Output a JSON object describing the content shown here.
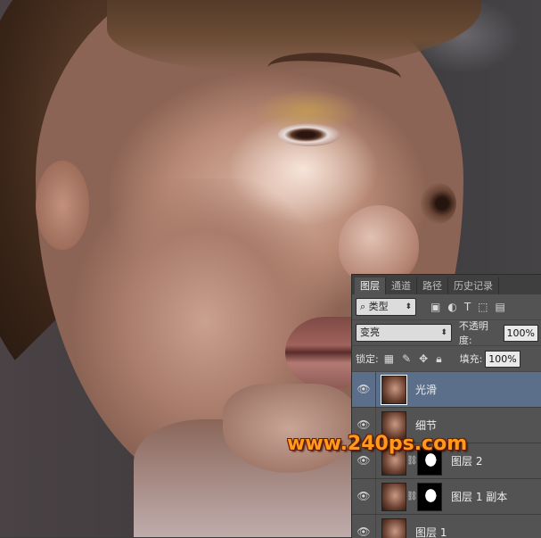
{
  "panel": {
    "tabs": [
      {
        "label": "图层",
        "active": true
      },
      {
        "label": "通道",
        "active": false
      },
      {
        "label": "路径",
        "active": false
      },
      {
        "label": "历史记录",
        "active": false
      }
    ],
    "filter": {
      "label": "类型",
      "icon": "search-icon"
    },
    "filter_icons": [
      "image-icon",
      "adjustment-circle-icon",
      "type-t-icon",
      "shape-icon",
      "smart-object-icon"
    ],
    "blend_mode": "变亮",
    "opacity_label": "不透明度:",
    "opacity_value": "100%",
    "lock_label": "锁定:",
    "lock_icons": [
      "lock-transparent-icon",
      "lock-brush-icon",
      "lock-move-icon",
      "lock-all-icon"
    ],
    "fill_label": "填充:",
    "fill_value": "100%",
    "layers": [
      {
        "name": "光滑",
        "selected": true,
        "has_mask": false
      },
      {
        "name": "细节",
        "selected": false,
        "has_mask": false
      },
      {
        "name": "图层 2",
        "selected": false,
        "has_mask": true
      },
      {
        "name": "图层 1 副本",
        "selected": false,
        "has_mask": true
      },
      {
        "name": "图层 1",
        "selected": false,
        "has_mask": false
      }
    ]
  },
  "watermark": "www.240ps.com",
  "colors": {
    "accent_selected": "#5c6f8a",
    "panel_bg": "#535353",
    "watermark": "#ff9a1a"
  }
}
